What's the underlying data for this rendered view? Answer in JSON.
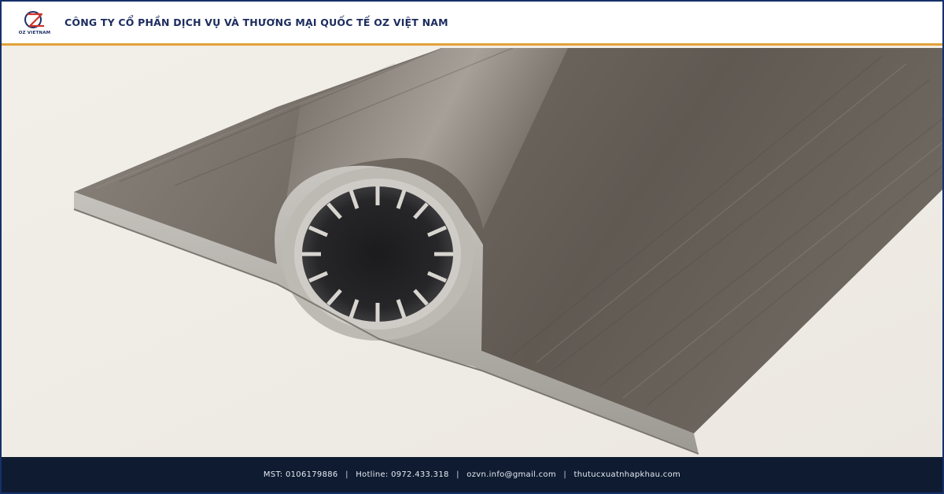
{
  "header": {
    "logo_text": "OZ VIETNAM",
    "company_name": "CÔNG TY CỔ PHẦN DỊCH VỤ VÀ THƯƠNG MẠI QUỐC TẾ OZ VIỆT NAM"
  },
  "photo": {
    "icon": "aluminum-finned-tube-profile"
  },
  "footer": {
    "mst": "MST: 0106179886",
    "hotline": "Hotline: 0972.433.318",
    "email": "ozvn.info@gmail.com",
    "website": "thutucxuatnhapkhau.com",
    "separator": "|"
  },
  "colors": {
    "brand_navy": "#16306b",
    "accent_orange": "#e2a23a",
    "logo_red": "#d0342c",
    "footer_bg": "#0e1b30"
  }
}
